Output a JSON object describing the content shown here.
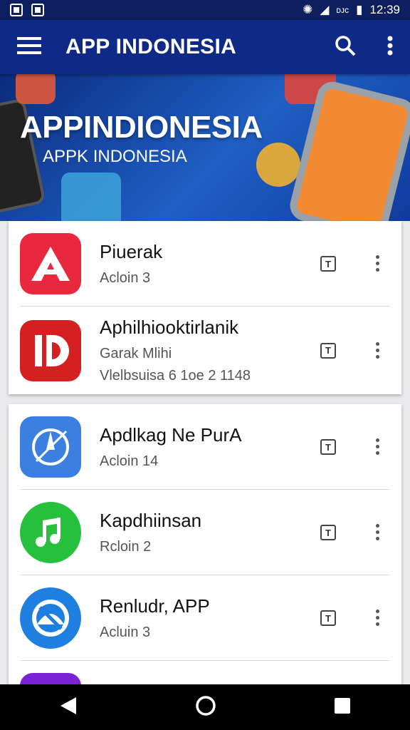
{
  "status_bar": {
    "time": "12:39",
    "battery_label": "ᴅᴊᴄ"
  },
  "app_bar": {
    "title": "APP INDONESIA"
  },
  "banner": {
    "title": "APPINDIONESIA",
    "subtitle": "APPK INDONESIA"
  },
  "lists": [
    {
      "items": [
        {
          "name": "Piuerak",
          "line1": "Acloin 3",
          "line2": "",
          "icon": "letter-a-icon",
          "color": "#e8283e",
          "download": "T"
        },
        {
          "name": "Aphilhiooktirlanik",
          "line1": "Garak Mlihi",
          "line2": "Vlelbsuisa 6 1oe 2 1148",
          "icon": "letter-d-icon",
          "color": "#d42020",
          "download": "T"
        }
      ]
    },
    {
      "items": [
        {
          "name": "Apdlkag Ne PurA",
          "line1": "Acloin 14",
          "line2": "",
          "icon": "compass-icon",
          "color": "#3b7fe0",
          "download": "T"
        },
        {
          "name": "Kapdhiinsan",
          "line1": "Rcloin 2",
          "line2": "",
          "icon": "music-note-icon",
          "color": "#27c03c",
          "download": "T"
        },
        {
          "name": "Renludr, APP",
          "line1": "Acluin 3",
          "line2": "",
          "icon": "globe-icon",
          "color": "#1e7fe0",
          "download": "T"
        },
        {
          "name": "",
          "line1": "",
          "line2": "",
          "icon": "app-icon",
          "color": "#7a22d8",
          "download": ""
        }
      ]
    }
  ],
  "nav": {
    "back": "back-icon",
    "home": "home-icon",
    "recents": "recents-icon"
  }
}
